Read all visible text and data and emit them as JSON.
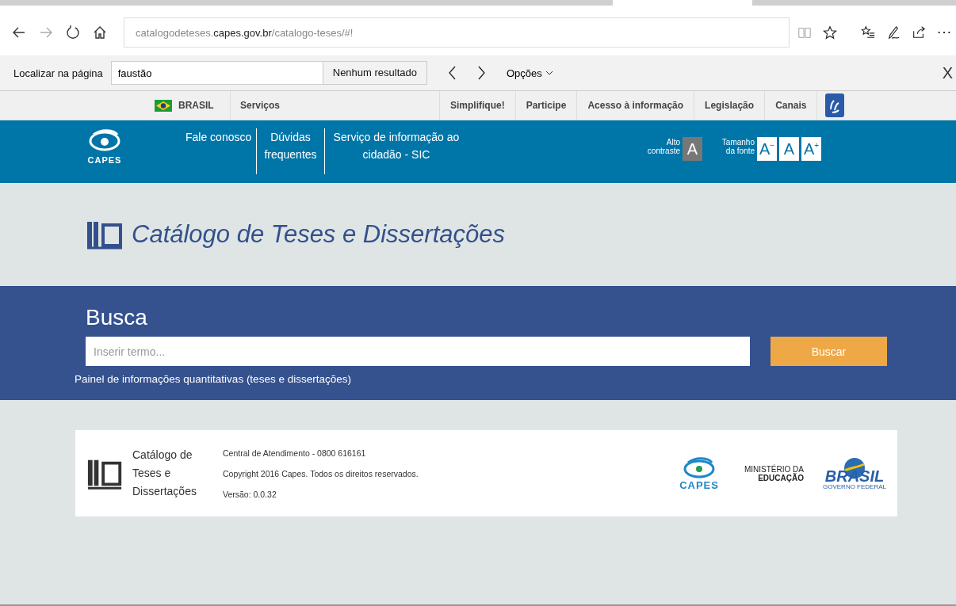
{
  "browser": {
    "url_prefix": "catalogodeteses.",
    "url_domain": "capes.gov.br",
    "url_path": "/catalogo-teses/#!"
  },
  "find_bar": {
    "label": "Localizar na página",
    "value": "faustão",
    "result": "Nenhum resultado",
    "options": "Opções",
    "close": "X"
  },
  "gov_bar": {
    "country": "BRASIL",
    "services": "Serviços",
    "links": [
      "Simplifique!",
      "Participe",
      "Acesso à informação",
      "Legislação",
      "Canais"
    ]
  },
  "header": {
    "logo": "CAPES",
    "nav": [
      {
        "label": "Fale conosco"
      },
      {
        "label": "Dúvidas frequentes"
      },
      {
        "label": "Serviço de informação ao cidadão - SIC"
      }
    ],
    "contrast_label": "Alto contraste",
    "contrast_button": "A",
    "font_label": "Tamanho da fonte",
    "font_buttons": [
      {
        "label": "A",
        "sup": "−"
      },
      {
        "label": "A"
      },
      {
        "label": "A",
        "sup": "+"
      }
    ]
  },
  "title": "Catálogo de Teses e Dissertações",
  "search": {
    "heading": "Busca",
    "placeholder": "Inserir termo...",
    "button": "Buscar",
    "link": "Painel de informações quantitativas (teses e dissertações)"
  },
  "footer": {
    "logo_text": "Catálogo de Teses e Dissertações",
    "lines": [
      "Central de Atendimento - 0800 616161",
      "Copyright 2016 Capes. Todos os direitos reservados.",
      "Versão: 0.0.32"
    ],
    "capes": "CAPES",
    "ministry": "MINISTÉRIO DA",
    "ministry_bold": "EDUCAÇÃO",
    "brasil": "BRASIL",
    "brasil_sub": "GOVERNO FEDERAL"
  }
}
